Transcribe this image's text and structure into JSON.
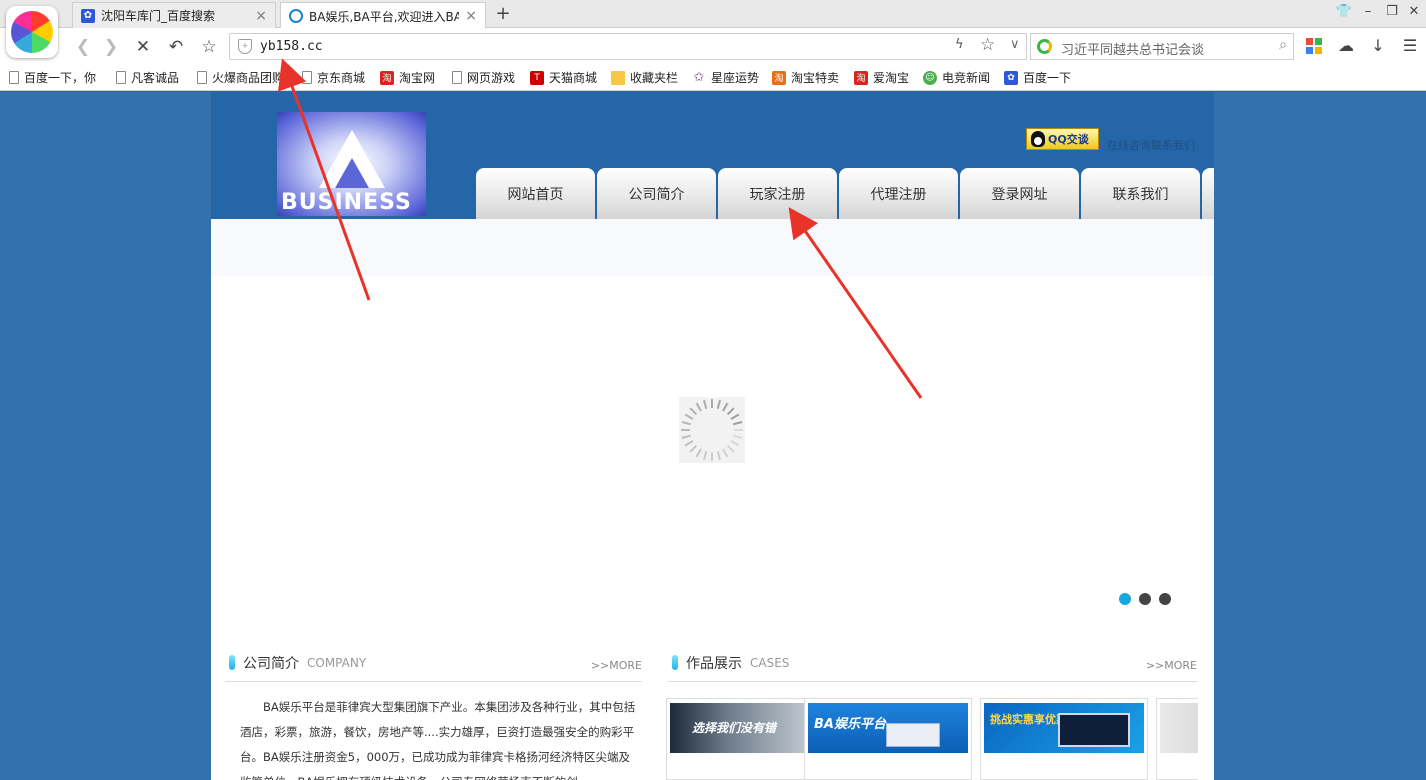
{
  "browser": {
    "tabs": [
      {
        "title": "沈阳车库门_百度搜索",
        "active": false
      },
      {
        "title": "BA娱乐,BA平台,欢迎进入BA娱",
        "active": true
      }
    ],
    "url": "yb158.cc",
    "search_placeholder": "习近平同越共总书记会谈",
    "bookmarks": [
      "百度一下，你",
      "凡客诚品",
      "火爆商品团购",
      "京东商城",
      "淘宝网",
      "网页游戏",
      "天猫商城",
      "收藏夹栏",
      "星座运势",
      "淘宝特卖",
      "爱淘宝",
      "电竞新闻",
      "百度一下"
    ]
  },
  "site": {
    "logo_text": "BUSINESS",
    "qq_label": "QQ交谈",
    "qq_note": "在线咨询联系我们",
    "nav": [
      "网站首页",
      "公司简介",
      "玩家注册",
      "代理注册",
      "登录网址",
      "联系我们"
    ],
    "slider_dots": 3,
    "slider_active": 0,
    "about": {
      "title": "公司简介",
      "title_en": "COMPANY",
      "more": ">>MORE",
      "text": "BA娱乐平台是菲律宾大型集团旗下产业。本集团涉及各种行业，其中包括酒店，彩票，旅游，餐饮，房地产等....实力雄厚，巨资打造最强安全的购彩平台。BA娱乐注册资金5，000万，已成功成为菲律宾卡格扬河经济特区尖端及监管单位，BA娱乐拥有顶级技术设备，公司专网络营扬克不断的创"
    },
    "cases": {
      "title": "作品展示",
      "title_en": "CASES",
      "more": ">>MORE",
      "items": [
        {
          "caption": "选择我们没有错"
        },
        {
          "caption": "BA娱乐平台"
        },
        {
          "caption": "挑战实惠享优惠"
        }
      ]
    }
  }
}
